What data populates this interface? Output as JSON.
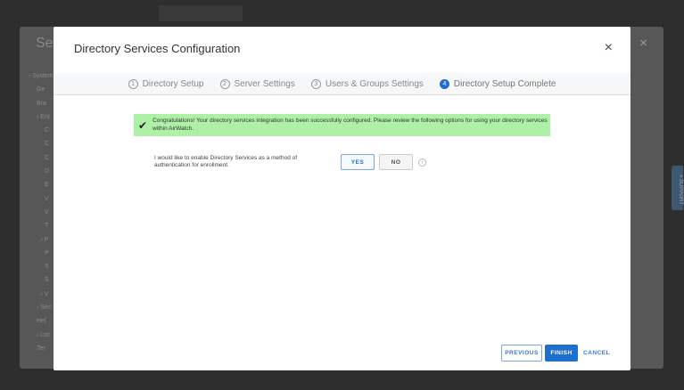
{
  "background": {
    "settings_title": "Set",
    "tree": [
      "› System",
      "Ge",
      "Bra",
      "› Ent",
      "C",
      "C",
      "C",
      "D",
      "E",
      "V",
      "V",
      "T",
      "› P",
      "P",
      "S",
      "S",
      "› V",
      "› Sec",
      "Hel",
      "› Loc",
      "Ter"
    ],
    "support_label": "« SUPPORT"
  },
  "modal": {
    "title": "Directory Services Configuration",
    "close_icon": "×",
    "steps": [
      {
        "num": "1",
        "label": "Directory Setup",
        "active": false
      },
      {
        "num": "2",
        "label": "Server Settings",
        "active": false
      },
      {
        "num": "3",
        "label": "Users & Groups Settings",
        "active": false
      },
      {
        "num": "4",
        "label": "Directory Setup Complete",
        "active": true
      }
    ],
    "banner": {
      "icon": "✔",
      "text": "Congratulations! Your directory services integration has been successfully configured. Please review the following options for using your directory services within AirWatch."
    },
    "question": "I would like to enable Directory Services as a method of authentication for enrollment.",
    "yes_label": "YES",
    "no_label": "NO",
    "info_icon": "i",
    "previous_label": "PREVIOUS",
    "finish_label": "FINISH",
    "cancel_label": "CANCEL"
  }
}
